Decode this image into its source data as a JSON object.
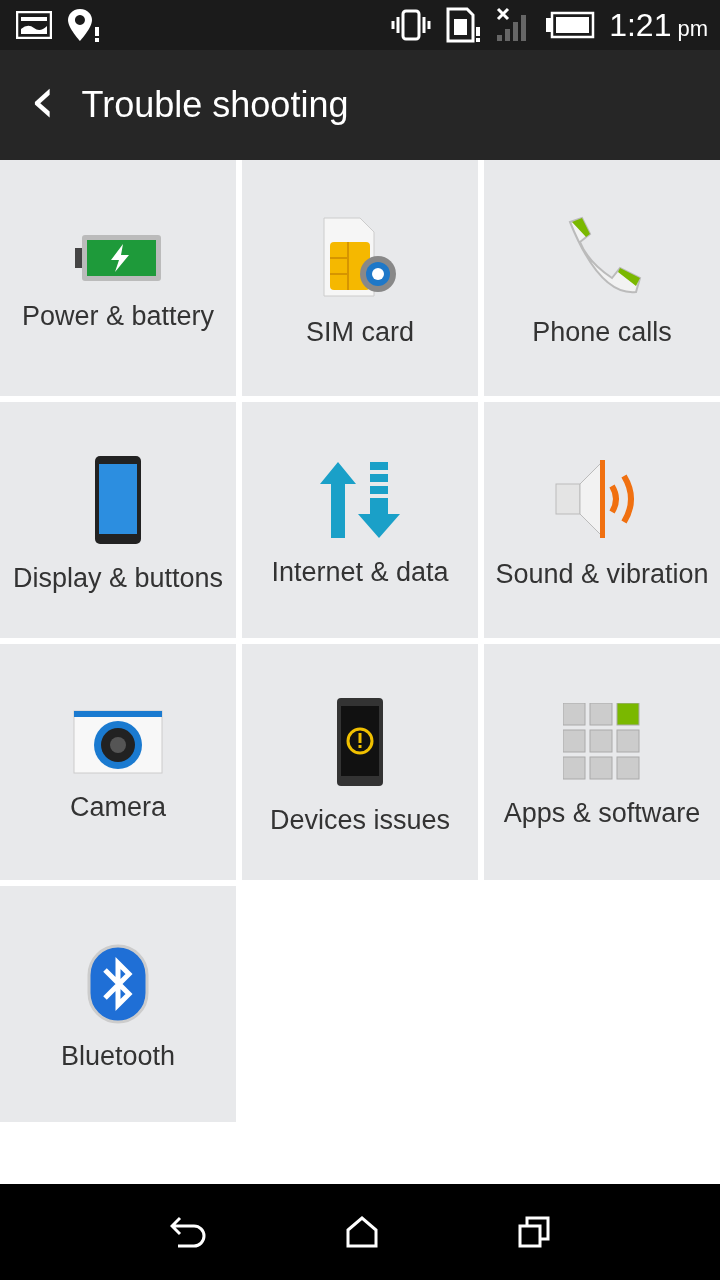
{
  "status_bar": {
    "time": "1:21",
    "period": "pm"
  },
  "app_bar": {
    "back": "‹",
    "title": "Trouble shooting"
  },
  "tiles": [
    {
      "label": "Power & battery",
      "kind": "battery"
    },
    {
      "label": "SIM card",
      "kind": "sim"
    },
    {
      "label": "Phone calls",
      "kind": "phone"
    },
    {
      "label": "Display & buttons",
      "kind": "display"
    },
    {
      "label": "Internet & data",
      "kind": "data"
    },
    {
      "label": "Sound & vibration",
      "kind": "sound"
    },
    {
      "label": "Camera",
      "kind": "camera"
    },
    {
      "label": "Devices issues",
      "kind": "device"
    },
    {
      "label": "Apps & software",
      "kind": "apps"
    },
    {
      "label": "Bluetooth",
      "kind": "bluetooth"
    }
  ]
}
